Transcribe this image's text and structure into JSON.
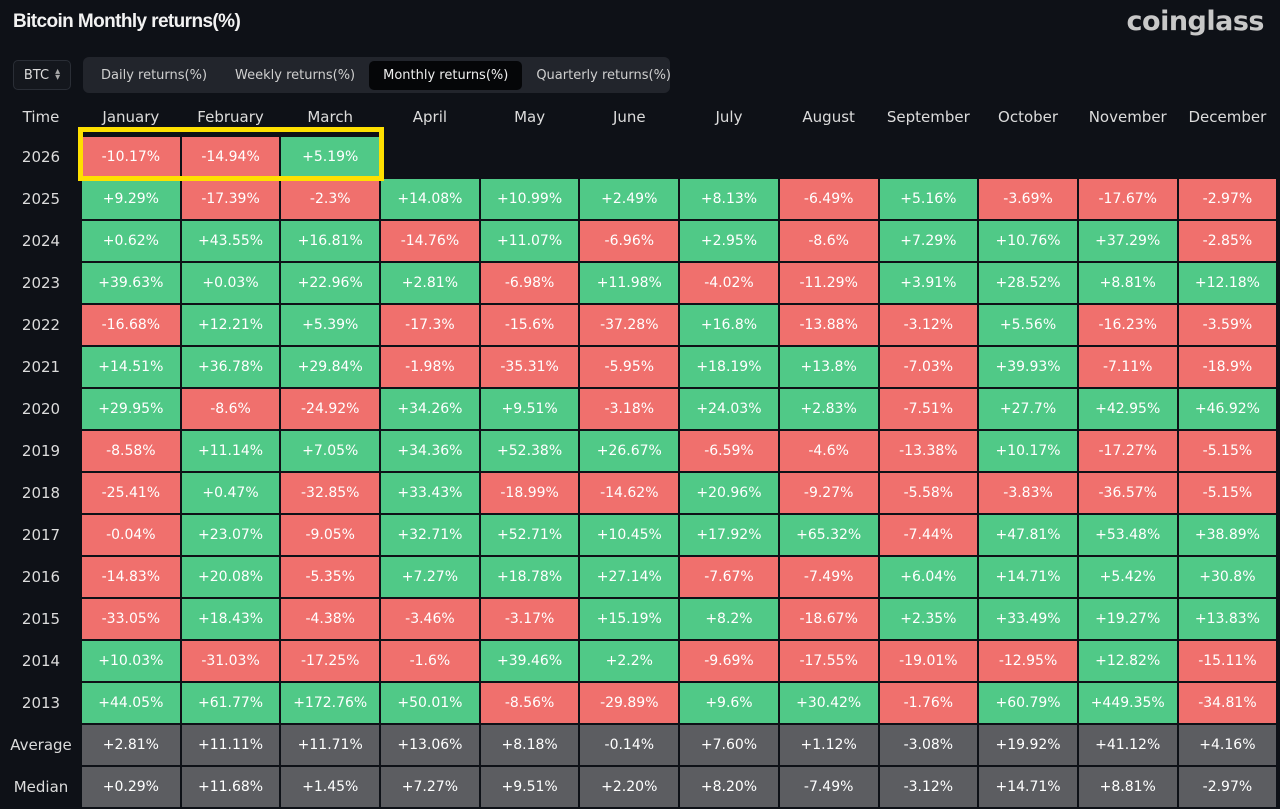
{
  "header": {
    "title": "Bitcoin Monthly returns(%)",
    "logo": "coinglass"
  },
  "asset_select": {
    "value": "BTC",
    "icon": "sort-updown-icon"
  },
  "tabs": [
    {
      "label": "Daily returns(%)",
      "active": false
    },
    {
      "label": "Weekly returns(%)",
      "active": false
    },
    {
      "label": "Monthly returns(%)",
      "active": true
    },
    {
      "label": "Quarterly returns(%)",
      "active": false
    }
  ],
  "colors": {
    "positive": "#50c987",
    "negative": "#f0706d",
    "stat": "#5c5d61",
    "highlight": "#ffe000"
  },
  "chart_data": {
    "type": "table",
    "title": "Bitcoin Monthly returns(%)",
    "corner_label": "Time",
    "columns": [
      "January",
      "February",
      "March",
      "April",
      "May",
      "June",
      "July",
      "August",
      "September",
      "October",
      "November",
      "December"
    ],
    "rows": [
      {
        "label": "2026",
        "values": [
          "-10.17%",
          "-14.94%",
          "+5.19%"
        ],
        "highlighted": true
      },
      {
        "label": "2025",
        "values": [
          "+9.29%",
          "-17.39%",
          "-2.3%",
          "+14.08%",
          "+10.99%",
          "+2.49%",
          "+8.13%",
          "-6.49%",
          "+5.16%",
          "-3.69%",
          "-17.67%",
          "-2.97%"
        ]
      },
      {
        "label": "2024",
        "values": [
          "+0.62%",
          "+43.55%",
          "+16.81%",
          "-14.76%",
          "+11.07%",
          "-6.96%",
          "+2.95%",
          "-8.6%",
          "+7.29%",
          "+10.76%",
          "+37.29%",
          "-2.85%"
        ]
      },
      {
        "label": "2023",
        "values": [
          "+39.63%",
          "+0.03%",
          "+22.96%",
          "+2.81%",
          "-6.98%",
          "+11.98%",
          "-4.02%",
          "-11.29%",
          "+3.91%",
          "+28.52%",
          "+8.81%",
          "+12.18%"
        ]
      },
      {
        "label": "2022",
        "values": [
          "-16.68%",
          "+12.21%",
          "+5.39%",
          "-17.3%",
          "-15.6%",
          "-37.28%",
          "+16.8%",
          "-13.88%",
          "-3.12%",
          "+5.56%",
          "-16.23%",
          "-3.59%"
        ]
      },
      {
        "label": "2021",
        "values": [
          "+14.51%",
          "+36.78%",
          "+29.84%",
          "-1.98%",
          "-35.31%",
          "-5.95%",
          "+18.19%",
          "+13.8%",
          "-7.03%",
          "+39.93%",
          "-7.11%",
          "-18.9%"
        ]
      },
      {
        "label": "2020",
        "values": [
          "+29.95%",
          "-8.6%",
          "-24.92%",
          "+34.26%",
          "+9.51%",
          "-3.18%",
          "+24.03%",
          "+2.83%",
          "-7.51%",
          "+27.7%",
          "+42.95%",
          "+46.92%"
        ]
      },
      {
        "label": "2019",
        "values": [
          "-8.58%",
          "+11.14%",
          "+7.05%",
          "+34.36%",
          "+52.38%",
          "+26.67%",
          "-6.59%",
          "-4.6%",
          "-13.38%",
          "+10.17%",
          "-17.27%",
          "-5.15%"
        ]
      },
      {
        "label": "2018",
        "values": [
          "-25.41%",
          "+0.47%",
          "-32.85%",
          "+33.43%",
          "-18.99%",
          "-14.62%",
          "+20.96%",
          "-9.27%",
          "-5.58%",
          "-3.83%",
          "-36.57%",
          "-5.15%"
        ]
      },
      {
        "label": "2017",
        "values": [
          "-0.04%",
          "+23.07%",
          "-9.05%",
          "+32.71%",
          "+52.71%",
          "+10.45%",
          "+17.92%",
          "+65.32%",
          "-7.44%",
          "+47.81%",
          "+53.48%",
          "+38.89%"
        ]
      },
      {
        "label": "2016",
        "values": [
          "-14.83%",
          "+20.08%",
          "-5.35%",
          "+7.27%",
          "+18.78%",
          "+27.14%",
          "-7.67%",
          "-7.49%",
          "+6.04%",
          "+14.71%",
          "+5.42%",
          "+30.8%"
        ]
      },
      {
        "label": "2015",
        "values": [
          "-33.05%",
          "+18.43%",
          "-4.38%",
          "-3.46%",
          "-3.17%",
          "+15.19%",
          "+8.2%",
          "-18.67%",
          "+2.35%",
          "+33.49%",
          "+19.27%",
          "+13.83%"
        ]
      },
      {
        "label": "2014",
        "values": [
          "+10.03%",
          "-31.03%",
          "-17.25%",
          "-1.6%",
          "+39.46%",
          "+2.2%",
          "-9.69%",
          "-17.55%",
          "-19.01%",
          "-12.95%",
          "+12.82%",
          "-15.11%"
        ]
      },
      {
        "label": "2013",
        "values": [
          "+44.05%",
          "+61.77%",
          "+172.76%",
          "+50.01%",
          "-8.56%",
          "-29.89%",
          "+9.6%",
          "+30.42%",
          "-1.76%",
          "+60.79%",
          "+449.35%",
          "-34.81%"
        ]
      }
    ],
    "stats": [
      {
        "label": "Average",
        "values": [
          "+2.81%",
          "+11.11%",
          "+11.71%",
          "+13.06%",
          "+8.18%",
          "-0.14%",
          "+7.60%",
          "+1.12%",
          "-3.08%",
          "+19.92%",
          "+41.12%",
          "+4.16%"
        ]
      },
      {
        "label": "Median",
        "values": [
          "+0.29%",
          "+11.68%",
          "+1.45%",
          "+7.27%",
          "+9.51%",
          "+2.20%",
          "+8.20%",
          "-7.49%",
          "-3.12%",
          "+14.71%",
          "+8.81%",
          "-2.97%"
        ]
      }
    ]
  }
}
